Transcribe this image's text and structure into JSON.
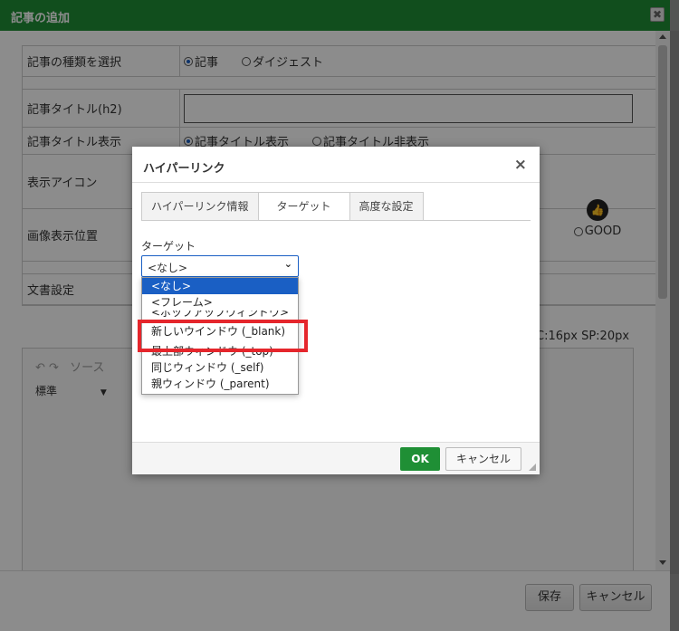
{
  "outer_dialog": {
    "title": "記事の追加",
    "close": "✖",
    "rows": {
      "type_label": "記事の種類を選択",
      "type_options": [
        "記事",
        "ダイジェスト"
      ],
      "title_label": "記事タイトル(h2)",
      "title_value": "",
      "title_display_label": "記事タイトル表示",
      "title_display_options": [
        "記事タイトル表示",
        "記事タイトル非表示"
      ],
      "icon_label": "表示アイコン",
      "icon_option": "GOOD",
      "image_pos_label": "画像表示位置",
      "text_settings_label": "文書設定"
    },
    "font_size_hint": "C:16px SP:20px",
    "editor": {
      "undo_redo": "↶ ↷",
      "source_label": "ソース",
      "format_label": "標準"
    },
    "save_label": "保存",
    "cancel_label": "キャンセル"
  },
  "hyperlink_dialog": {
    "title": "ハイパーリンク",
    "close": "×",
    "tabs": [
      "ハイパーリンク情報",
      "ターゲット",
      "高度な設定"
    ],
    "active_tab": "ターゲット",
    "target_label": "ターゲット",
    "selected_value": "<なし>",
    "options": [
      "<なし>",
      "<フレーム>",
      "<ポップアップウィンドウ>",
      "新しいウインドウ (_blank)",
      "最上部ウィンドウ (_top)",
      "同じウィンドウ (_self)",
      "親ウィンドウ (_parent)"
    ],
    "ok_label": "OK",
    "cancel_label": "キャンセル"
  },
  "colors": {
    "title_bar": "#1f8f35",
    "ok_button": "#1f8f35",
    "selection": "#1a5fc4",
    "highlight": "#e5262c"
  }
}
